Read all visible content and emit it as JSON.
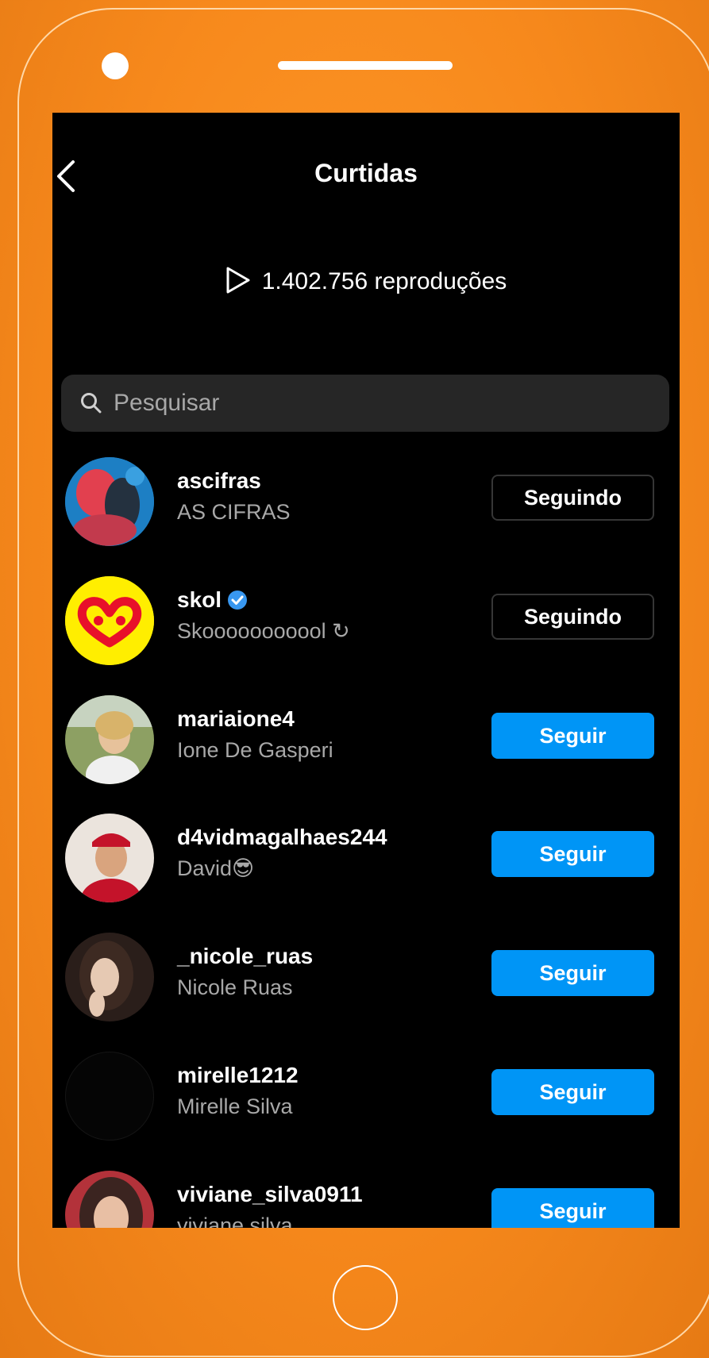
{
  "header": {
    "title": "Curtidas",
    "back_icon": "chevron-left-icon"
  },
  "stats": {
    "plays_text": "1.402.756 reproduções",
    "icon": "play-icon"
  },
  "search": {
    "placeholder": "Pesquisar",
    "value": "",
    "icon": "search-icon"
  },
  "colors": {
    "background": "#f7891c",
    "screen": "#000000",
    "follow_button": "#0095f6",
    "verified": "#3897f0"
  },
  "users": [
    {
      "username": "ascifras",
      "full_name": "AS CIFRAS",
      "button": "Seguindo",
      "following": true
    },
    {
      "username": "skol",
      "full_name": "Skooooooooool ↻",
      "button": "Seguindo",
      "following": true,
      "verified": true
    },
    {
      "username": "mariaione4",
      "full_name": "Ione De Gasperi",
      "button": "Seguir",
      "following": false
    },
    {
      "username": "d4vidmagalhaes244",
      "full_name": "David😎",
      "button": "Seguir",
      "following": false
    },
    {
      "username": "_nicole_ruas",
      "full_name": "Nicole Ruas",
      "button": "Seguir",
      "following": false
    },
    {
      "username": "mirelle1212",
      "full_name": "Mirelle Silva",
      "button": "Seguir",
      "following": false
    },
    {
      "username": "viviane_silva0911",
      "full_name": "viviane silva",
      "button": "Seguir",
      "following": false
    }
  ]
}
